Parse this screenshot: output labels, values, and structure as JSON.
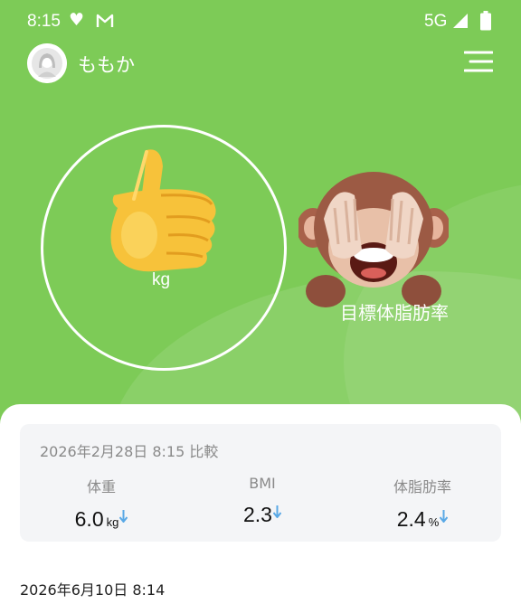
{
  "status_bar": {
    "time": "8:15",
    "network": "5G",
    "icons": [
      "heart-icon",
      "gmail-icon",
      "signal-icon",
      "battery-icon"
    ]
  },
  "header": {
    "user_name": "ももか",
    "avatar": "avatar",
    "menu_icon": "menu-icon"
  },
  "gauge": {
    "unit": "kg",
    "emoji": "thumbs-up-icon",
    "ring_color": "#ffffff"
  },
  "target": {
    "label": "目標体脂肪率",
    "emoji": "see-no-evil-monkey-icon"
  },
  "comparison": {
    "title": "2026年2月28日 8:15 比較",
    "metrics": [
      {
        "label": "体重",
        "value": "6.0",
        "unit": "kg",
        "trend": "down"
      },
      {
        "label": "BMI",
        "value": "2.3",
        "unit": "",
        "trend": "down"
      },
      {
        "label": "体脂肪率",
        "value": "2.4",
        "unit": "%",
        "trend": "down"
      }
    ]
  },
  "history": {
    "date": "2026年6月10日 8:14"
  },
  "colors": {
    "background": "#7dcb57",
    "card": "#f4f5f7",
    "trend_arrow": "#5aa9e6"
  }
}
